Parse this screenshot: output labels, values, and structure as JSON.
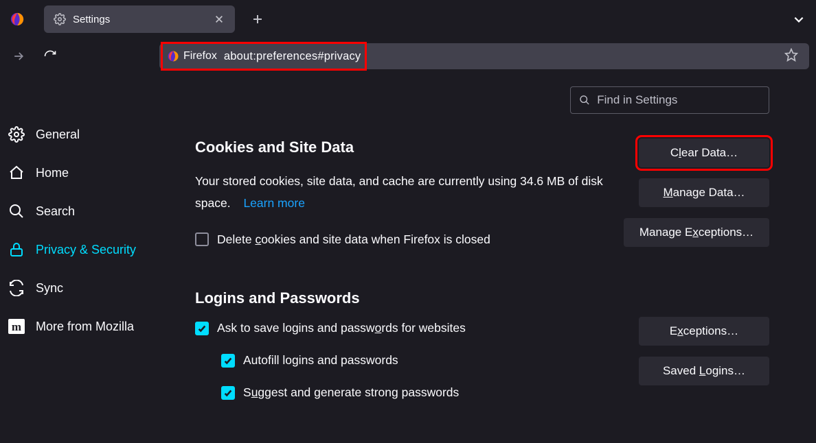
{
  "tab": {
    "title": "Settings"
  },
  "url": {
    "label": "Firefox",
    "path": "about:preferences#privacy"
  },
  "search": {
    "placeholder": "Find in Settings"
  },
  "sidebar": {
    "items": [
      {
        "label": "General"
      },
      {
        "label": "Home"
      },
      {
        "label": "Search"
      },
      {
        "label": "Privacy & Security"
      },
      {
        "label": "Sync"
      },
      {
        "label": "More from Mozilla"
      }
    ]
  },
  "cookies": {
    "heading": "Cookies and Site Data",
    "desc_pre": "Your stored cookies, site data, and cache are currently using 34.6 MB of disk space.",
    "learn_more": "Learn more",
    "delete_on_close_pre": "Delete ",
    "delete_on_close_u": "c",
    "delete_on_close_post": "ookies and site data when Firefox is closed",
    "clear_pre": "C",
    "clear_u": "l",
    "clear_post": "ear Data…",
    "manage_pre": "",
    "manage_u": "M",
    "manage_post": "anage Data…",
    "exceptions_pre": "Manage E",
    "exceptions_u": "x",
    "exceptions_post": "ceptions…"
  },
  "logins": {
    "heading": "Logins and Passwords",
    "ask_pre": "Ask to save logins and passw",
    "ask_u": "o",
    "ask_post": "rds for websites",
    "autofill": "Autofill logins and passwords",
    "suggest_pre": "S",
    "suggest_u": "u",
    "suggest_post": "ggest and generate strong passwords",
    "exceptions_pre": "E",
    "exceptions_u": "x",
    "exceptions_post": "ceptions…",
    "saved_pre": "Saved ",
    "saved_u": "L",
    "saved_post": "ogins…"
  }
}
